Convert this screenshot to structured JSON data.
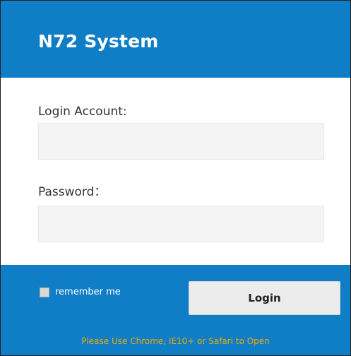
{
  "app": {
    "title": "N72 System"
  },
  "form": {
    "account_label": "Login Account:",
    "account_value": "",
    "password_label": "Password：",
    "password_value": ""
  },
  "footer": {
    "remember_label": "remember me",
    "remember_checked": false,
    "login_label": "Login",
    "browser_note": "Please Use Chrome, IE10+ or Safari to Open"
  },
  "colors": {
    "brand_blue": "#0f7ec6",
    "note_orange": "#f2a900",
    "input_bg": "#f4f4f4"
  }
}
